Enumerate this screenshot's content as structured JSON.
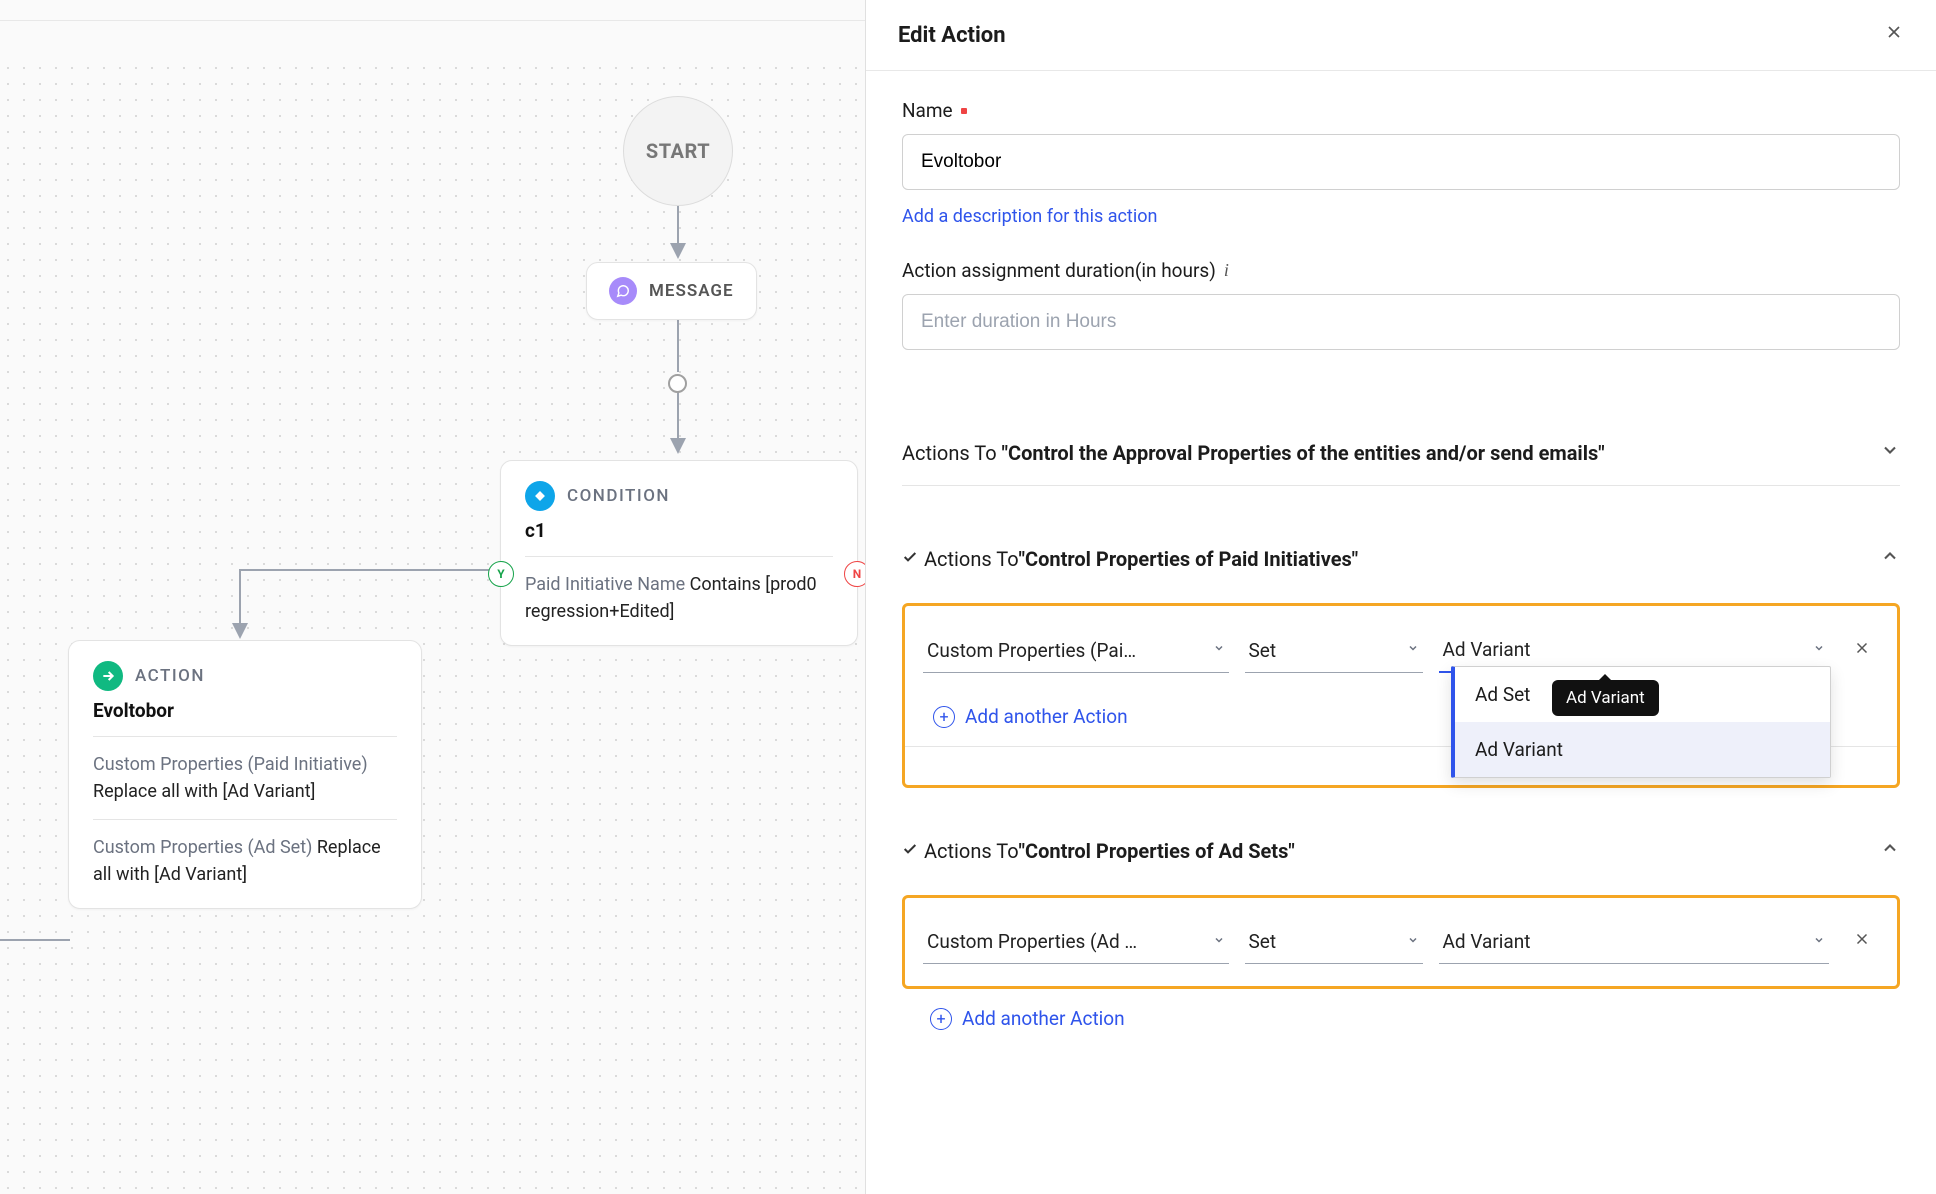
{
  "canvas": {
    "start_label": "START",
    "message_label": "MESSAGE",
    "condition": {
      "type_label": "CONDITION",
      "title": "c1",
      "desc_prefix": "Paid Initiative Name ",
      "desc_strong": "Contains [prod0 regression+Edited]",
      "port_y": "Y",
      "port_n": "N"
    },
    "action": {
      "type_label": "ACTION",
      "title": "Evoltobor",
      "line1_prefix": "Custom Properties (Paid Initiative) ",
      "line1_strong": "Replace all with [Ad Variant]",
      "line2_prefix": "Custom Properties (Ad Set) ",
      "line2_strong": "Replace all with [Ad Variant]"
    }
  },
  "panel": {
    "title": "Edit Action",
    "name_label": "Name",
    "name_value": "Evoltobor",
    "add_description_link": "Add a description for this action",
    "duration_label": "Action assignment duration(in hours)",
    "duration_placeholder": "Enter duration in Hours",
    "section1_prefix": "Actions To ",
    "section1_bold": "\"Control the Approval Properties of the entities and/or send emails\"",
    "section2_prefix": "Actions To ",
    "section2_bold": "\"Control Properties of Paid Initiatives\"",
    "section3_prefix": "Actions To ",
    "section3_bold": "\"Control Properties of Ad Sets\"",
    "row_paid": {
      "prop": "Custom Properties (Pai…",
      "op": "Set",
      "val": "Ad Variant"
    },
    "row_adset": {
      "prop": "Custom Properties (Ad …",
      "op": "Set",
      "val": "Ad Variant"
    },
    "add_another": "Add another Action",
    "dropdown": {
      "opt1": "Ad Set",
      "opt2": "Ad Variant"
    },
    "tooltip": "Ad Variant"
  }
}
